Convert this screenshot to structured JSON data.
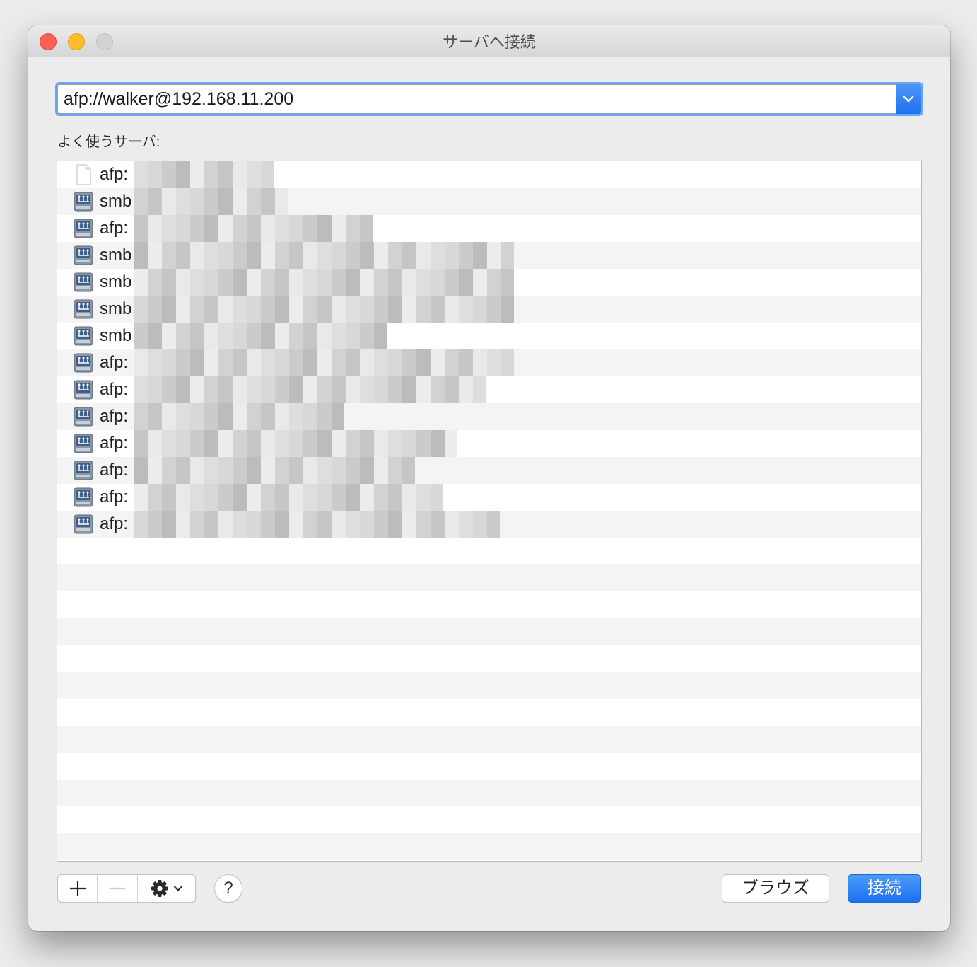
{
  "window": {
    "title": "サーバへ接続"
  },
  "address": {
    "value": "afp://walker@192.168.11.200"
  },
  "favorites": {
    "label": "よく使うサーバ:",
    "items": [
      {
        "prefix": "afp:",
        "icon": "document-icon",
        "blur_width": 198
      },
      {
        "prefix": "smb",
        "icon": "network-server-icon",
        "blur_width": 218
      },
      {
        "prefix": "afp:",
        "icon": "network-server-icon",
        "blur_width": 338
      },
      {
        "prefix": "smb",
        "icon": "network-server-icon",
        "blur_width": 538
      },
      {
        "prefix": "smb",
        "icon": "network-server-icon",
        "blur_width": 538
      },
      {
        "prefix": "smb",
        "icon": "network-server-icon",
        "blur_width": 538
      },
      {
        "prefix": "smb",
        "icon": "network-server-icon",
        "blur_width": 358
      },
      {
        "prefix": "afp:",
        "icon": "network-server-icon",
        "blur_width": 538
      },
      {
        "prefix": "afp:",
        "icon": "network-server-icon",
        "blur_width": 498
      },
      {
        "prefix": "afp:",
        "icon": "network-server-icon",
        "blur_width": 298
      },
      {
        "prefix": "afp:",
        "icon": "network-server-icon",
        "blur_width": 458
      },
      {
        "prefix": "afp:",
        "icon": "network-server-icon",
        "blur_width": 398
      },
      {
        "prefix": "afp:",
        "icon": "network-server-icon",
        "blur_width": 438
      },
      {
        "prefix": "afp:",
        "icon": "network-server-icon",
        "blur_width": 518
      }
    ]
  },
  "toolbar": {
    "add_label": "+",
    "remove_label": "−",
    "help_label": "?"
  },
  "buttons": {
    "browse_label": "ブラウズ",
    "connect_label": "接続"
  },
  "colors": {
    "accent": "#1c6ff0",
    "close": "#fe5f57",
    "minimize": "#febc2e",
    "zoom_inactive": "#d3d3d3"
  }
}
